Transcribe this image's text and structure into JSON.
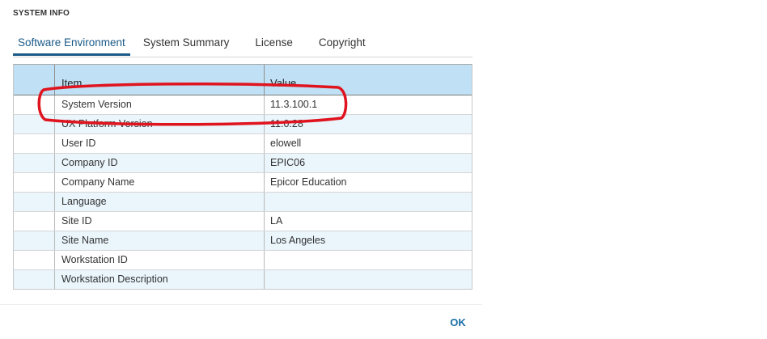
{
  "dialog": {
    "title": "SYSTEM INFO",
    "ok_label": "OK"
  },
  "tabs": [
    {
      "label": "Software Environment",
      "active": true
    },
    {
      "label": "System Summary",
      "active": false
    },
    {
      "label": "License",
      "active": false
    },
    {
      "label": "Copyright",
      "active": false
    }
  ],
  "grid": {
    "columns": [
      "Item",
      "Value"
    ],
    "rows": [
      {
        "item": "System Version",
        "value": "11.3.100.1"
      },
      {
        "item": "UX Platform Version",
        "value": "11.0.28"
      },
      {
        "item": "User ID",
        "value": "elowell"
      },
      {
        "item": "Company ID",
        "value": "EPIC06"
      },
      {
        "item": "Company Name",
        "value": "Epicor Education"
      },
      {
        "item": "Language",
        "value": ""
      },
      {
        "item": "Site ID",
        "value": "LA"
      },
      {
        "item": "Site Name",
        "value": "Los Angeles"
      },
      {
        "item": "Workstation ID",
        "value": ""
      },
      {
        "item": "Workstation Description",
        "value": ""
      }
    ]
  },
  "colors": {
    "accent": "#1a5a87",
    "header_bg": "#bfe0f5",
    "alt_row_bg": "#eaf5fc",
    "annotation": "#e0141e"
  }
}
